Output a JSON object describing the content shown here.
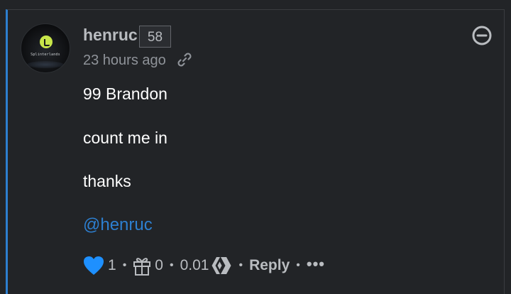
{
  "comment": {
    "author": "henruc",
    "reputation": "58",
    "timestamp": "23 hours ago",
    "avatar_text": "Splinterlands",
    "body": [
      "99 Brandon",
      "count me in",
      "thanks"
    ],
    "mention": "@henruc"
  },
  "actions": {
    "votes": "1",
    "tips": "0",
    "payout": "0.01",
    "reply_label": "Reply",
    "more_label": "•••",
    "separator": "•"
  },
  "colors": {
    "accent": "#2d7fd0",
    "heart": "#1e90ff",
    "background": "#222427"
  },
  "icons": {
    "link": "link-icon",
    "collapse": "minus-circle-icon",
    "vote": "heart-icon",
    "tip": "gift-icon",
    "currency": "hive-icon"
  }
}
